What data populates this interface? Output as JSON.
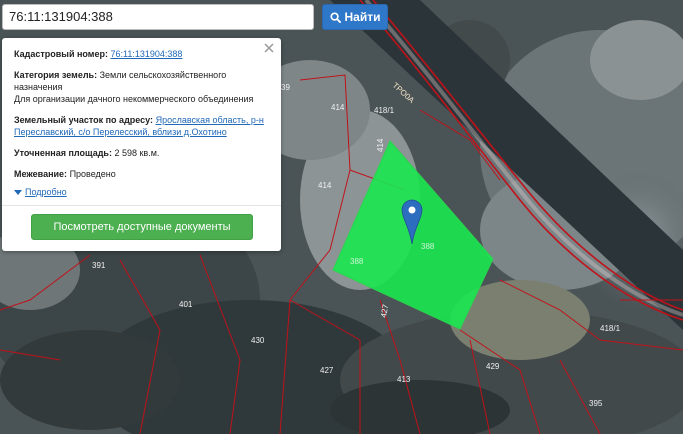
{
  "search": {
    "value": "76:11:131904:388",
    "button_label": "Найти"
  },
  "card": {
    "cadastral_label": "Кадастровый номер:",
    "cadastral_value": "76:11:131904:388",
    "category_label": "Категория земель:",
    "category_value": "Земли сельскохозяйственного назначения",
    "category_note": "Для организации дачного некоммерческого объединения",
    "address_label": "Земельный участок по адресу:",
    "address_value": "Ярославская область, р-н Переславский, с/о Перелесский, вблизи д.Охотино",
    "area_label": "Уточненная площадь:",
    "area_value": "2 598 кв.м.",
    "survey_label": "Межевание:",
    "survey_value": "Проведено",
    "more_link": "Подробно",
    "docs_button": "Посмотреть доступные документы"
  },
  "map": {
    "parcel_labels": [
      "414",
      "418/1",
      "414",
      "414",
      "391",
      "401",
      "430",
      "427",
      "427",
      "413",
      "429",
      "395",
      "418/1",
      "388",
      "388",
      "39"
    ],
    "road_label": "ТРО0А",
    "colors": {
      "parcel_fill": "#19e84f",
      "parcel_border": "#c0121a",
      "marker": "#2d6dbf"
    }
  }
}
